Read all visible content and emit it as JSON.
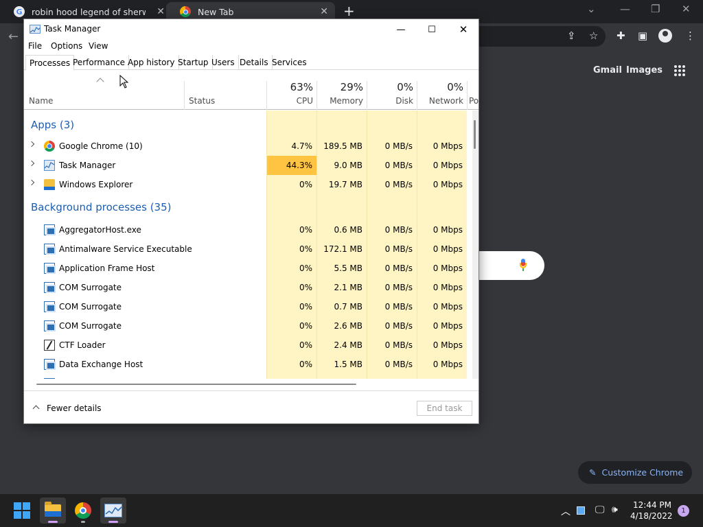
{
  "chrome": {
    "tabs": [
      {
        "title": "robin hood legend of sherwood",
        "close": "✕"
      },
      {
        "title": "New Tab",
        "close": "✕"
      }
    ],
    "new_tab": "+",
    "ntp": {
      "gmail": "Gmail",
      "images": "Images",
      "customize": "Customize Chrome"
    }
  },
  "task_manager": {
    "title": "Task Manager",
    "menu": [
      "File",
      "Options",
      "View"
    ],
    "tabs": [
      "Processes",
      "Performance",
      "App history",
      "Startup",
      "Users",
      "Details",
      "Services"
    ],
    "active_tab": "Processes",
    "columns": {
      "name": "Name",
      "status": "Status",
      "cpu": {
        "pct": "63%",
        "label": "CPU"
      },
      "memory": {
        "pct": "29%",
        "label": "Memory"
      },
      "disk": {
        "pct": "0%",
        "label": "Disk"
      },
      "network": {
        "pct": "0%",
        "label": "Network"
      },
      "power": {
        "label": "Po"
      }
    },
    "groups": {
      "apps": "Apps (3)",
      "background": "Background processes (35)"
    },
    "apps": [
      {
        "name": "Google Chrome (10)",
        "icon": "chrome-icon",
        "cpu": "4.7%",
        "memory": "189.5 MB",
        "disk": "0 MB/s",
        "network": "0 Mbps"
      },
      {
        "name": "Task Manager",
        "icon": "task-manager-icon",
        "cpu": "44.3%",
        "memory": "9.0 MB",
        "disk": "0 MB/s",
        "network": "0 Mbps"
      },
      {
        "name": "Windows Explorer",
        "icon": "folder-icon",
        "cpu": "0%",
        "memory": "19.7 MB",
        "disk": "0 MB/s",
        "network": "0 Mbps"
      }
    ],
    "background": [
      {
        "name": "AggregatorHost.exe",
        "icon": "service-icon",
        "cpu": "0%",
        "memory": "0.6 MB",
        "disk": "0 MB/s",
        "network": "0 Mbps"
      },
      {
        "name": "Antimalware Service Executable",
        "icon": "service-icon",
        "cpu": "0%",
        "memory": "172.1 MB",
        "disk": "0 MB/s",
        "network": "0 Mbps"
      },
      {
        "name": "Application Frame Host",
        "icon": "service-icon",
        "cpu": "0%",
        "memory": "5.5 MB",
        "disk": "0 MB/s",
        "network": "0 Mbps"
      },
      {
        "name": "COM Surrogate",
        "icon": "service-icon",
        "cpu": "0%",
        "memory": "2.1 MB",
        "disk": "0 MB/s",
        "network": "0 Mbps"
      },
      {
        "name": "COM Surrogate",
        "icon": "service-icon",
        "cpu": "0%",
        "memory": "0.7 MB",
        "disk": "0 MB/s",
        "network": "0 Mbps"
      },
      {
        "name": "COM Surrogate",
        "icon": "service-icon",
        "cpu": "0%",
        "memory": "2.6 MB",
        "disk": "0 MB/s",
        "network": "0 Mbps"
      },
      {
        "name": "CTF Loader",
        "icon": "ctf-loader-icon",
        "cpu": "0%",
        "memory": "2.4 MB",
        "disk": "0 MB/s",
        "network": "0 Mbps"
      },
      {
        "name": "Data Exchange Host",
        "icon": "service-icon",
        "cpu": "0%",
        "memory": "1.5 MB",
        "disk": "0 MB/s",
        "network": "0 Mbps"
      }
    ],
    "footer": {
      "fewer_details": "Fewer details",
      "end_task": "End task"
    },
    "colors": {
      "heat_light": "#fff4c4",
      "heat_hot": "#ffc441",
      "group_text": "#1b5eb1"
    }
  },
  "taskbar": {
    "time": "12:44 PM",
    "date": "4/18/2022",
    "notifications": "1"
  }
}
